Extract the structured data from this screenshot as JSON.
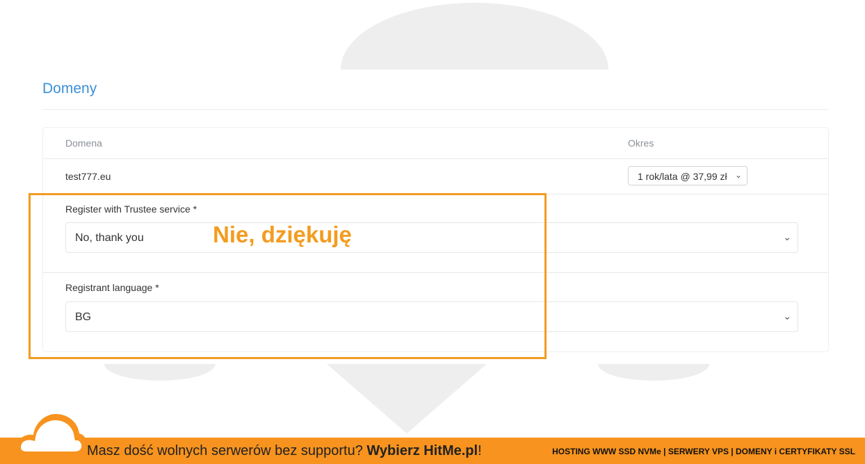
{
  "section": {
    "title": "Domeny"
  },
  "table": {
    "headers": {
      "domain": "Domena",
      "period": "Okres"
    },
    "row": {
      "domain": "test777.eu",
      "period_selected": "1 rok/lata @ 37,99 zł"
    }
  },
  "fields": {
    "trustee": {
      "label": "Register with Trustee service *",
      "value": "No, thank you"
    },
    "language": {
      "label": "Registrant language *",
      "value": "BG"
    }
  },
  "annotation": {
    "text": "Nie, dziękuję",
    "color": "#f39c1f"
  },
  "footer": {
    "text_prefix": "Masz dość wolnych serwerów bez supportu? ",
    "text_bold": "Wybierz HitMe.pl",
    "text_suffix": "!",
    "links": "HOSTING WWW SSD NVMe | SERWERY VPS | DOMENY i CERTYFIKATY SSL",
    "color": "#f7931e"
  },
  "icons": {
    "dropdown": "chevron-down-icon",
    "logo": "cloud-logo-icon"
  },
  "colors": {
    "accent": "#3b8fd8"
  }
}
